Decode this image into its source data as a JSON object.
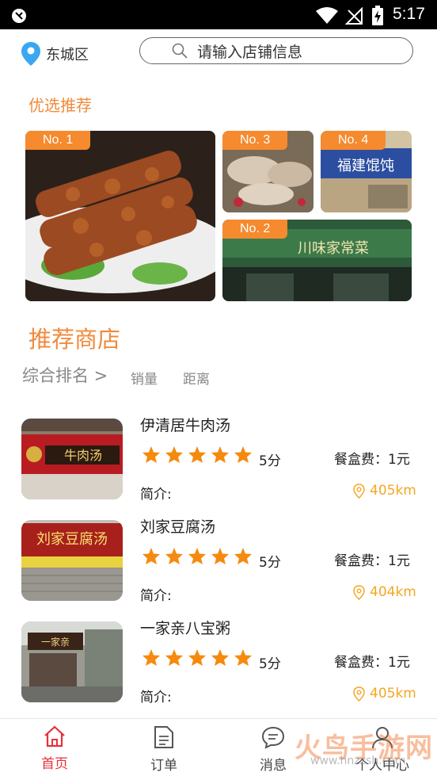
{
  "status": {
    "time": "5:17"
  },
  "header": {
    "city": "东城区",
    "search_placeholder": "请输入店铺信息"
  },
  "featured": {
    "title": "优选推荐",
    "items": [
      {
        "tag": "No. 1"
      },
      {
        "tag": "No. 3"
      },
      {
        "tag": "No. 4"
      },
      {
        "tag": "No. 2"
      }
    ]
  },
  "recommend": {
    "title": "推荐商店",
    "sort": {
      "main": "综合排名 >",
      "sales": "销量",
      "distance": "距离"
    }
  },
  "shops": [
    {
      "name": "伊清居牛肉汤",
      "rating": 5,
      "score": "5分",
      "fee": "餐盒费：1元",
      "intro": "简介:",
      "distance": "405km",
      "sign": "牛肉汤"
    },
    {
      "name": "刘家豆腐汤",
      "rating": 5,
      "score": "5分",
      "fee": "餐盒费：1元",
      "intro": "简介:",
      "distance": "404km",
      "sign": "刘家豆腐汤"
    },
    {
      "name": "一家亲八宝粥",
      "rating": 5,
      "score": "5分",
      "fee": "餐盒费：1元",
      "intro": "简介:",
      "distance": "405km",
      "sign": "一家亲"
    }
  ],
  "tabs": [
    {
      "label": "首页"
    },
    {
      "label": "订单"
    },
    {
      "label": "消息"
    },
    {
      "label": "个人中心"
    }
  ],
  "watermark": {
    "text": "火鸟手游网",
    "url": "www.hnzzsh.com"
  },
  "colors": {
    "accent": "#f08a3c",
    "star": "#f58a0e",
    "active_tab": "#e8303a",
    "distance": "#f5a623"
  }
}
